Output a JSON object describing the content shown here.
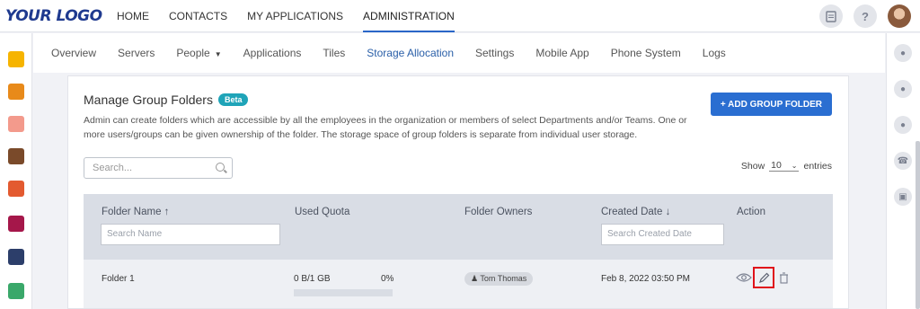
{
  "brand": {
    "logo": "YOUR LOGO"
  },
  "top_nav": {
    "items": [
      "HOME",
      "CONTACTS",
      "MY APPLICATIONS",
      "ADMINISTRATION"
    ],
    "active": "ADMINISTRATION"
  },
  "top_right": {
    "notes_icon": "clipboard-icon",
    "help_icon": "?"
  },
  "sub_nav": {
    "items": [
      "Overview",
      "Servers",
      "People",
      "Applications",
      "Tiles",
      "Storage Allocation",
      "Settings",
      "Mobile App",
      "Phone System",
      "Logs"
    ],
    "active": "Storage Allocation",
    "dropdown_item": "People"
  },
  "card": {
    "title": "Manage Group Folders",
    "badge": "Beta",
    "description": "Admin can create folders which are accessible by all the employees in the organization or members of select Departments and/or Teams. One or more users/groups can be given ownership of the folder. The storage space of group folders is separate from individual user storage.",
    "add_button": "+ ADD GROUP FOLDER",
    "search_placeholder": "Search...",
    "show_label": "Show",
    "show_value": "10",
    "entries_label": "entries"
  },
  "table": {
    "columns": [
      {
        "label": "Folder Name ↑"
      },
      {
        "label": "Used Quota"
      },
      {
        "label": "Folder Owners"
      },
      {
        "label": "Created Date ↓"
      },
      {
        "label": "Action"
      }
    ],
    "filters": {
      "name_placeholder": "Search Name",
      "date_placeholder": "Search Created Date"
    },
    "rows": [
      {
        "folder_name": "Folder 1",
        "used_quota": "0 B/1 GB",
        "quota_percent": "0%",
        "owner": "Tom Thomas",
        "created": "Feb 8, 2022 03:50 PM"
      }
    ]
  },
  "colors": {
    "accent": "#2a6ed1",
    "beta": "#1fa4b8",
    "highlight": "#e0121a"
  }
}
